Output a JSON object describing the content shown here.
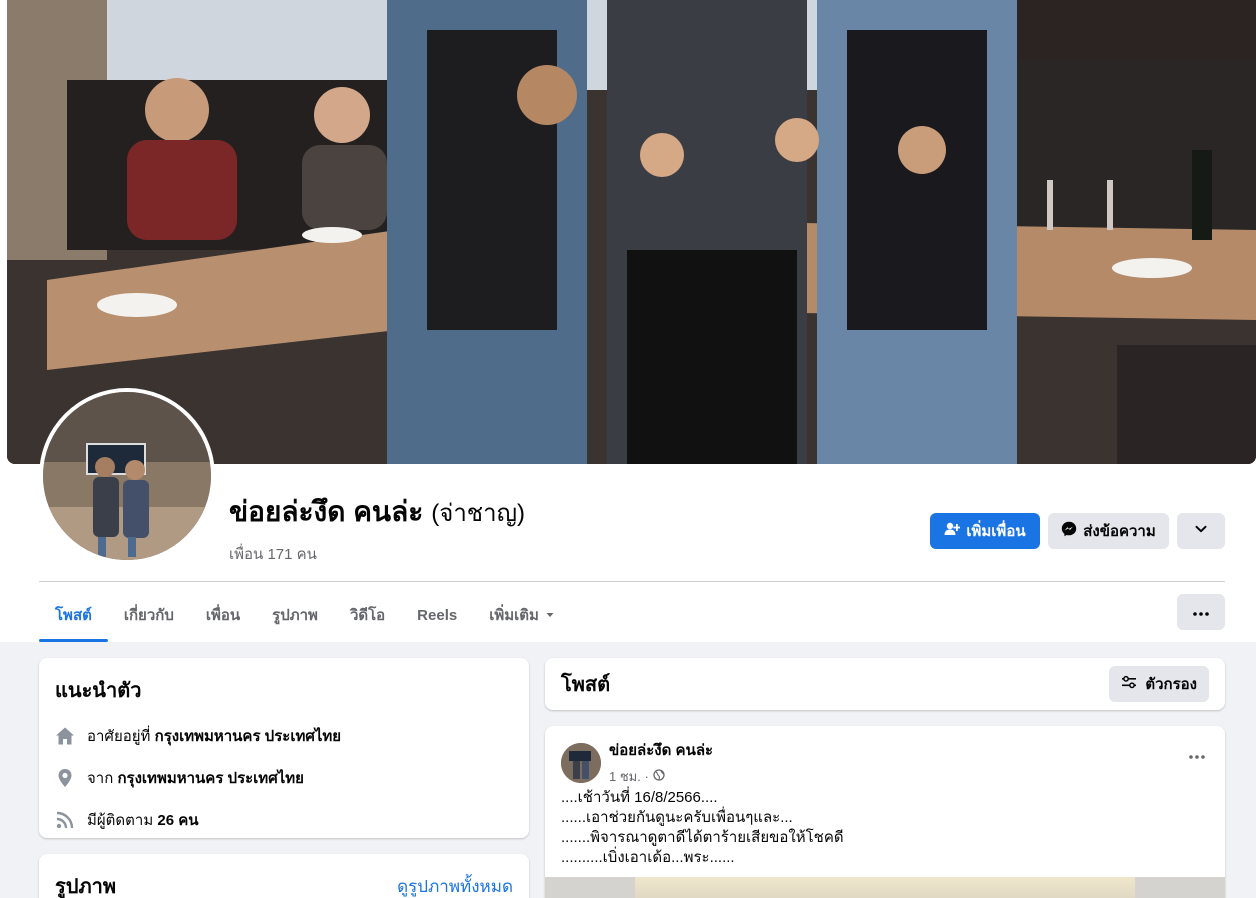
{
  "profile": {
    "name": "ข่อยล่ะงึด คนล่ะ",
    "alternate_name": "(จ่าชาญ)",
    "friends_count": "เพื่อน 171 คน"
  },
  "actions": {
    "add_friend": "เพิ่มเพื่อน",
    "message": "ส่งข้อความ"
  },
  "tabs": [
    {
      "label": "โพสต์",
      "active": true
    },
    {
      "label": "เกี่ยวกับ"
    },
    {
      "label": "เพื่อน"
    },
    {
      "label": "รูปภาพ"
    },
    {
      "label": "วิดีโอ"
    },
    {
      "label": "Reels"
    },
    {
      "label": "เพิ่มเติม"
    }
  ],
  "intro": {
    "title": "แนะนำตัว",
    "lives_prefix": "อาศัยอยู่ที่",
    "lives_value": "กรุงเทพมหานคร ประเทศไทย",
    "from_prefix": "จาก",
    "from_value": "กรุงเทพมหานคร ประเทศไทย",
    "followers_prefix": "มีผู้ติดตาม",
    "followers_value": "26 คน"
  },
  "photos": {
    "title": "รูปภาพ",
    "see_all": "ดูรูปภาพทั้งหมด"
  },
  "posts": {
    "title": "โพสต์",
    "filter_label": "ตัวกรอง"
  },
  "post": {
    "author": "ข่อยล่ะงึด คนล่ะ",
    "time": "1 ชม. ·",
    "lines": [
      "....เช้าวันที่ 16/8/2566....",
      "......เอาช่วยกันดูนะครับเพื่อนๆและ...",
      ".......พิจารณาดูตาดีได้ตาร้ายเสียขอให้โชคดี",
      "..........เบิ่งเอาเด้อ...พระ......"
    ]
  },
  "colors": {
    "accent": "#1b74e4",
    "page_bg": "#f0f2f5",
    "secondary_button": "#e4e6eb"
  },
  "icons": {
    "add_friend": "person-plus-icon",
    "message": "messenger-icon",
    "more": "chevron-down-icon",
    "home": "home-icon",
    "location": "location-pin-icon",
    "followers": "rss-icon",
    "filter": "sliders-icon",
    "privacy": "globe-icon"
  }
}
